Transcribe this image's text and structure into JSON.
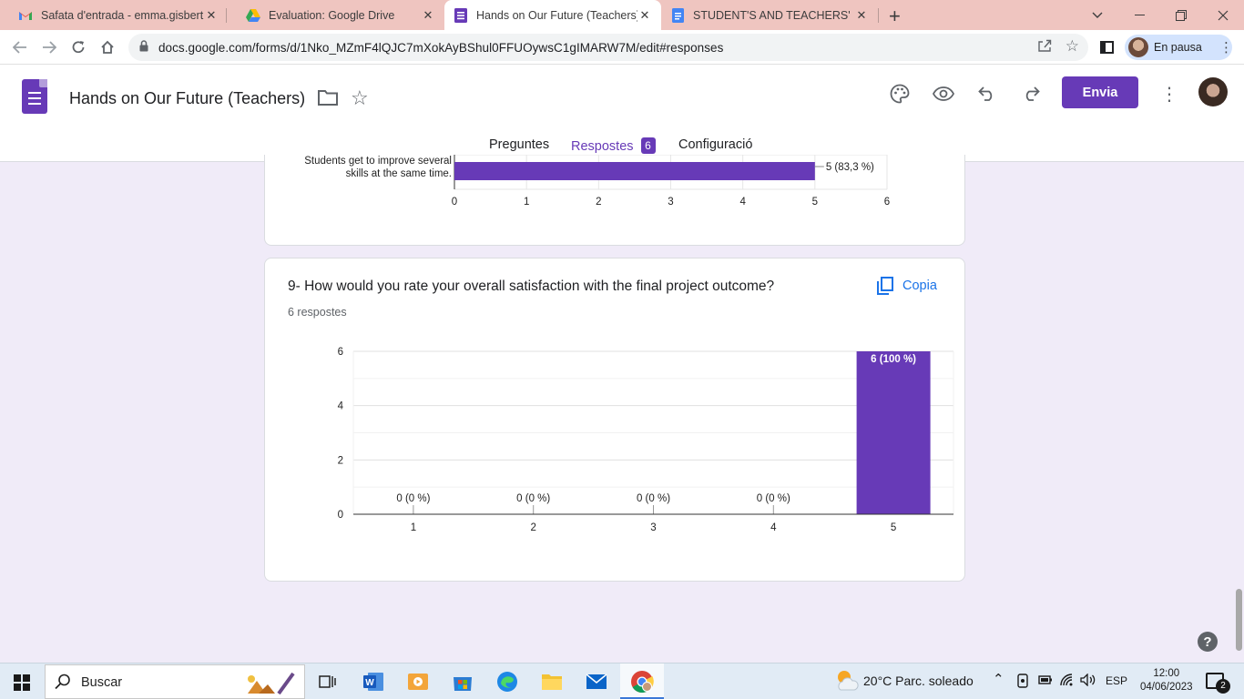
{
  "browser": {
    "tabs": [
      {
        "title": "Safata d'entrada - emma.gisbert@",
        "close": "✕"
      },
      {
        "title": "Evaluation: Google Drive",
        "close": "✕"
      },
      {
        "title": "Hands on Our Future (Teachers) -",
        "close": "✕"
      },
      {
        "title": "STUDENT'S AND TEACHERS' EVA",
        "close": "✕"
      }
    ],
    "new_tab": "+",
    "url": "docs.google.com/forms/d/1Nko_MZmF4lQJC7mXokAyBShul0FFUOywsC1gIMARW7M/edit#responses",
    "profile_status": "En pausa"
  },
  "form": {
    "title": "Hands on Our Future (Teachers)",
    "send_label": "Envia",
    "tabs": {
      "questions": "Preguntes",
      "responses": "Respostes",
      "responses_count": "6",
      "settings": "Configuració"
    }
  },
  "question8": {
    "row_label_line1": "Students get to improve several",
    "row_label_line2": "skills at the same time.",
    "value_label": "5 (83,3 %)"
  },
  "question9": {
    "title": "9- How would you rate your overall satisfaction with the final project outcome?",
    "responses": "6 respostes",
    "copy_label": "Copia"
  },
  "chart_data": [
    {
      "type": "bar",
      "orientation": "horizontal",
      "categories": [
        "Students get to improve several skills at the same time."
      ],
      "values": [
        5
      ],
      "data_labels": [
        "5 (83,3 %)"
      ],
      "xlim": [
        0,
        6
      ],
      "x_ticks": [
        "0",
        "1",
        "2",
        "3",
        "4",
        "5",
        "6"
      ],
      "color": "#673ab7"
    },
    {
      "type": "bar",
      "categories": [
        "1",
        "2",
        "3",
        "4",
        "5"
      ],
      "values": [
        0,
        0,
        0,
        0,
        6
      ],
      "data_labels": [
        "0 (0 %)",
        "0 (0 %)",
        "0 (0 %)",
        "0 (0 %)",
        "6 (100 %)"
      ],
      "ylim": [
        0,
        6
      ],
      "y_ticks": [
        "0",
        "2",
        "4",
        "6"
      ],
      "grid": true,
      "color": "#673ab7"
    }
  ],
  "taskbar": {
    "search_placeholder": "Buscar",
    "weather": "20°C  Parc. soleado",
    "language": "ESP",
    "time": "12:00",
    "date": "04/06/2023",
    "notifications": "2"
  },
  "colors": {
    "accent": "#673ab7",
    "link": "#1a73e8",
    "background": "#f0ebf8",
    "tab_strip": "#efc5c0"
  },
  "help_label": "?"
}
